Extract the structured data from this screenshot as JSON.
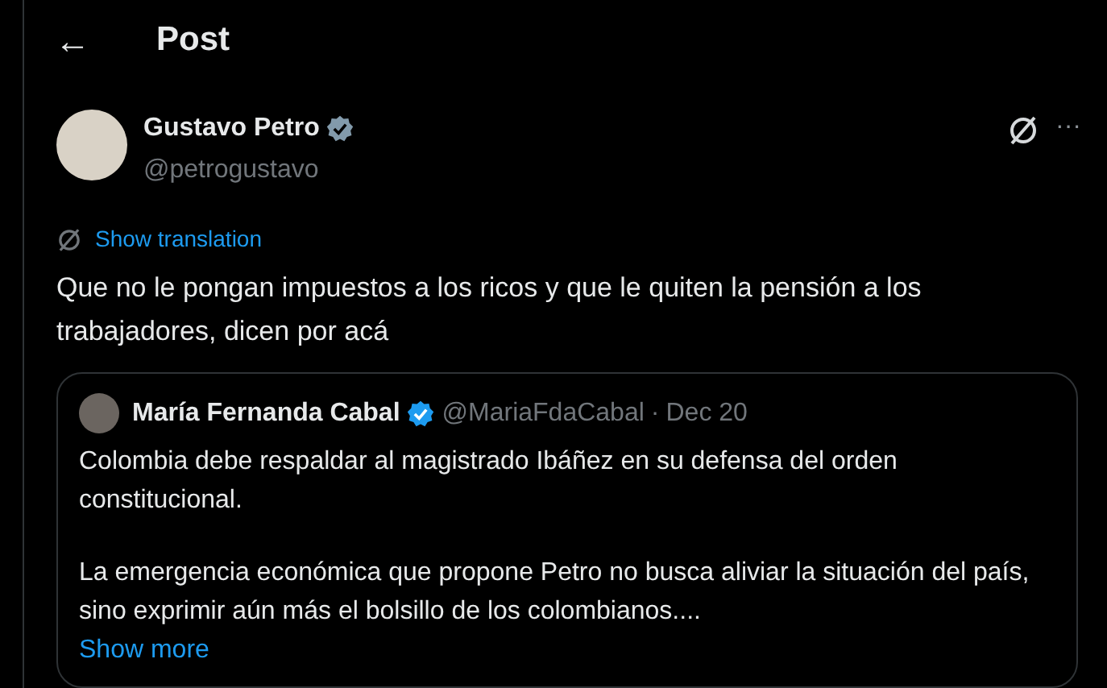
{
  "header": {
    "back": "←",
    "title": "Post"
  },
  "post": {
    "author": "Gustavo Petro",
    "verified": true,
    "handle": "@petrogustavo",
    "more": "···",
    "translate": "Show translation",
    "text": "Que no le pongan impuestos a los ricos y que le quiten la pensión a los trabajadores, dicen por acá",
    "quote": {
      "author": "María Fernanda Cabal",
      "verified": true,
      "handle": "@MariaFdaCabal",
      "separator": "·",
      "date": "Dec 20",
      "paragraphs": [
        "Colombia debe respaldar al magistrado Ibáñez en su defensa del orden constitucional.",
        "La emergencia económica que propone Petro no busca aliviar la situación del país, sino exprimir aún más el bolsillo de los colombianos...."
      ],
      "show_more": "Show more"
    }
  }
}
